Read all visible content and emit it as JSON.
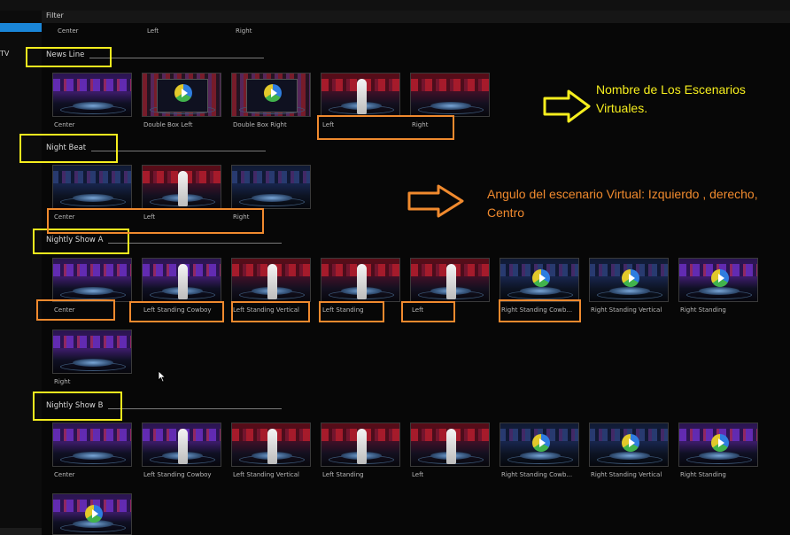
{
  "filter_label": "Filter",
  "sidebar": {
    "tv_label": "TV",
    "accent": "#1a86d8"
  },
  "top_captions": [
    "Center",
    "Left",
    "Right"
  ],
  "sections": [
    {
      "name": "News Line",
      "items": [
        "Center",
        "Double Box Left",
        "Double Box Right",
        "Left",
        "Right"
      ]
    },
    {
      "name": "Night Beat",
      "items": [
        "Center",
        "Left",
        "Right"
      ]
    },
    {
      "name": "Nightly Show A",
      "items": [
        "Center",
        "Left Standing Cowboy",
        "Left Standing Vertical",
        "Left Standing",
        "Left",
        "Right Standing Cowb...",
        "Right Standing Vertical",
        "Right Standing",
        "Right"
      ]
    },
    {
      "name": "Nightly Show B",
      "items": [
        "Center",
        "Left Standing Cowboy",
        "Left Standing Vertical",
        "Left Standing",
        "Left",
        "Right Standing Cowb...",
        "Right Standing Vertical",
        "Right Standing"
      ]
    }
  ],
  "annotations": {
    "names_note": "Nombre de Los Escenarios Virtuales.",
    "angle_note": "Angulo del escenario Virtual: Izquierdo , derecho, Centro",
    "yellow": "#f6ee1e",
    "orange": "#f08a2e"
  }
}
